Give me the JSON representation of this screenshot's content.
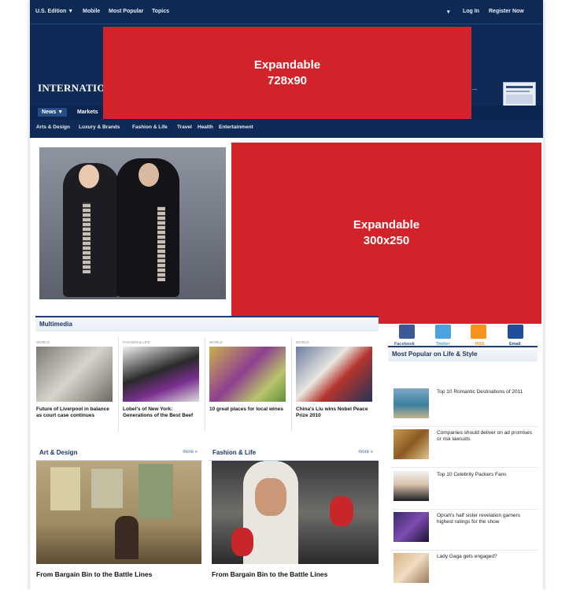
{
  "topbar": {
    "edition": "U.S. Edition",
    "mobile": "Mobile",
    "most_popular": "Most Popular",
    "topics": "Topics",
    "login": "Log In",
    "register": "Register Now"
  },
  "masthead": {
    "logo": "INTERNATION"
  },
  "nav": {
    "news": "News",
    "markets": "Markets"
  },
  "subnav": [
    "Arts & Design",
    "Luxury & Brands",
    "Fashion & Life",
    "Travel",
    "Health",
    "Entertainment"
  ],
  "ads": {
    "leaderboard": {
      "line1": "Expandable",
      "line2": "728x90"
    },
    "rectangle": {
      "line1": "Expandable",
      "line2": "300x250"
    }
  },
  "multimedia": {
    "title": "Multimedia",
    "items": [
      {
        "kicker": "WORLD",
        "caption": "Future of Liverpool in balance as court case continues"
      },
      {
        "kicker": "FASHION & LIFE",
        "caption": "Lobel's of New York: Generations of the Best Beef"
      },
      {
        "kicker": "WORLD",
        "caption": "10 great places for local wines"
      },
      {
        "kicker": "WORLD",
        "caption": "China's Liu wins Nobel Peace Prize 2010"
      }
    ]
  },
  "social": [
    {
      "name": "facebook-icon",
      "label": "Facebook",
      "color": "#3b5998"
    },
    {
      "name": "twitter-icon",
      "label": "Twitter",
      "color": "#4aa3df"
    },
    {
      "name": "rss-icon",
      "label": "RSS",
      "color": "#f7931e"
    },
    {
      "name": "email-icon",
      "label": "Email",
      "color": "#1f4f99"
    }
  ],
  "popular": {
    "title": "Most Popular on Life & Style",
    "items": [
      {
        "text": "Top 10 Romantic Destinations of 2011"
      },
      {
        "text": "Companies should deliver on ad promises or risk lawsuits"
      },
      {
        "text": "Top 10 Celebrity Packers Fans"
      },
      {
        "text": "Oprah's half sister revelation garners highest ratings for the show"
      },
      {
        "text": "Lady Gaga gets engaged?"
      }
    ]
  },
  "art_design": {
    "title": "Art & Design",
    "more": "more »",
    "headline": "From Bargain Bin to the Battle Lines"
  },
  "fashion_life": {
    "title": "Fashion & Life",
    "more": "more »",
    "headline": "From Bargain Bin to the Battle Lines"
  },
  "colors": {
    "header_bg": "#0e2b57",
    "ad_red": "#d3232a",
    "section_rule": "#1f3f74"
  }
}
